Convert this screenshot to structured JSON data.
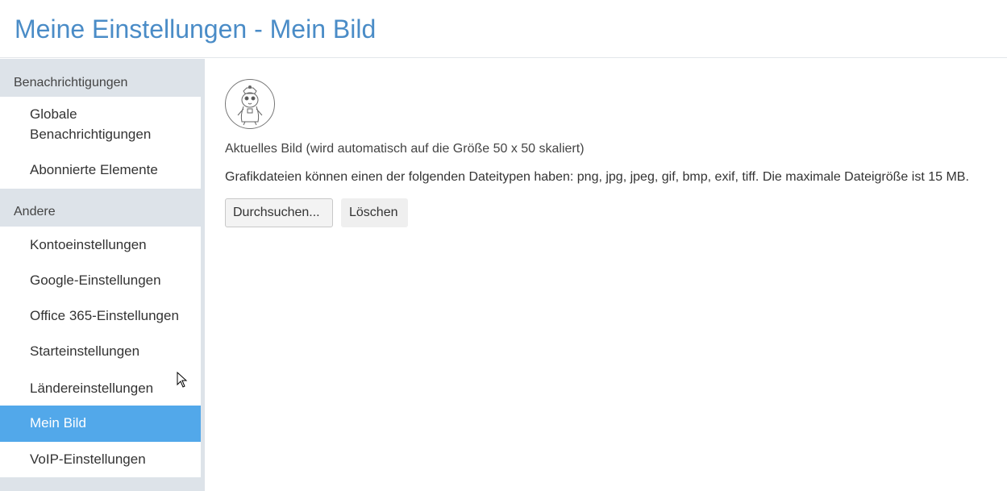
{
  "page": {
    "title": "Meine Einstellungen - Mein Bild"
  },
  "sidebar": {
    "sections": [
      {
        "header": "Benachrichtigungen",
        "items": [
          {
            "label": "Globale Benachrichtigungen",
            "active": false
          },
          {
            "label": "Abonnierte Elemente",
            "active": false
          }
        ]
      },
      {
        "header": "Andere",
        "items": [
          {
            "label": "Kontoeinstellungen",
            "active": false
          },
          {
            "label": "Google-Einstellungen",
            "active": false
          },
          {
            "label": "Office 365-Einstellungen",
            "active": false
          },
          {
            "label": "Starteinstellungen",
            "active": false
          },
          {
            "label": "Ländereinstellungen",
            "active": false
          },
          {
            "label": "Mein Bild",
            "active": true
          },
          {
            "label": "VoIP-Einstellungen",
            "active": false
          }
        ]
      }
    ]
  },
  "content": {
    "avatar_icon": "user-avatar-drawing-icon",
    "current_image_label": "Aktuelles Bild (wird automatisch auf die Größe 50 x 50 skaliert)",
    "filetypes_text": "Grafikdateien können einen der folgenden Dateitypen haben: png, jpg, jpeg, gif, bmp, exif, tiff. Die maximale Dateigröße ist 15 MB.",
    "browse_button": "Durchsuchen...",
    "delete_button": "Löschen"
  },
  "colors": {
    "accent": "#4a8cc7",
    "active_item": "#52a8ea",
    "sidebar_bg": "#dde3e9"
  }
}
